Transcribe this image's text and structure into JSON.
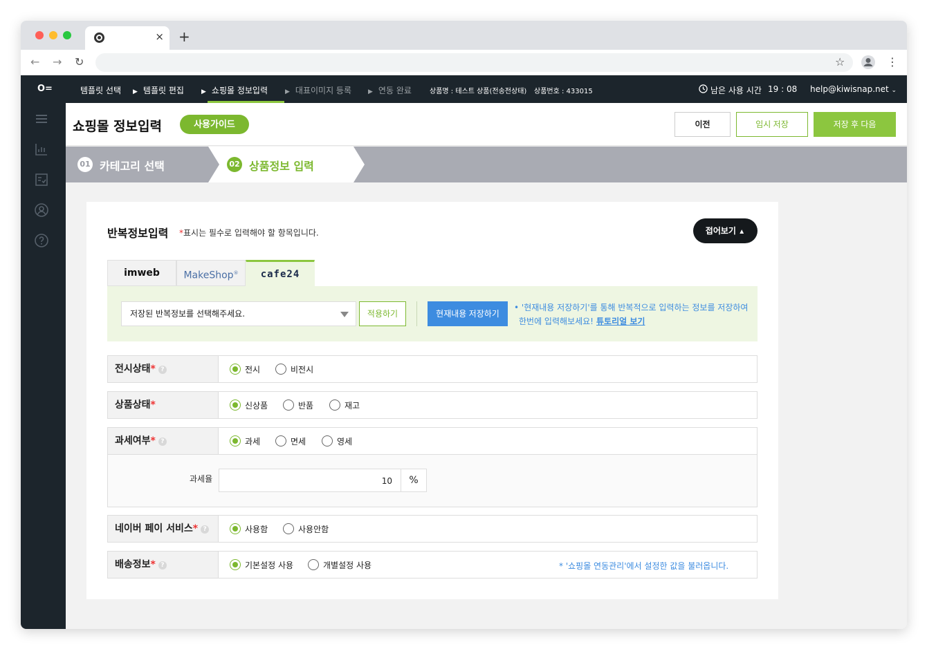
{
  "browser": {
    "tab_close": "×",
    "new_tab": "+",
    "back": "←",
    "forward": "→",
    "reload": "↻",
    "star": "☆",
    "menu": "⋮"
  },
  "topnav": {
    "logo": "O=",
    "steps": [
      {
        "label": "템플릿 선택",
        "active": true
      },
      {
        "label": "템플릿 편집",
        "active": true
      },
      {
        "label": "쇼핑몰 정보입력",
        "active": true
      },
      {
        "label": "대표이미지 등록",
        "active": false
      },
      {
        "label": "연동 완료",
        "active": false
      }
    ],
    "arrow": "▶",
    "product_name": "상품명 : 테스트 상품(전송전상태)",
    "product_no": "상품번호 : 433015",
    "time_label": "남은 사용 시간",
    "time_value": "19 : 08",
    "email": "help@kiwisnap.net"
  },
  "header": {
    "title": "쇼핑몰 정보입력",
    "guide": "사용가이드",
    "prev": "이전",
    "temp_save": "임시 저장",
    "save_next": "저장 후 다음"
  },
  "stepbar": {
    "step1_no": "01",
    "step1": "카테고리 선택",
    "step2_no": "02",
    "step2": "상품정보 입력"
  },
  "section": {
    "title": "반복정보입력",
    "note_star": "*",
    "note": "표시는 필수로 입력해야 할 항목입니다.",
    "fold": "접어보기"
  },
  "platform_tabs": [
    {
      "label": "imweb",
      "active": false
    },
    {
      "label": "MakeShop",
      "sup": "®",
      "active": false
    },
    {
      "label": "cafe24",
      "active": true
    }
  ],
  "repeat": {
    "select_placeholder": "저장된 반복정보를 선택해주세요.",
    "apply": "적용하기",
    "save_current": "현재내용 저장하기",
    "tip1": "• '현재내용 저장하기'를 통해 반복적으로 입력하는 정보를 저장하여",
    "tip2": "한번에 입력해보세요!",
    "tip_link": "튜토리얼 보기"
  },
  "fields": {
    "display": {
      "label": "전시상태",
      "options": [
        "전시",
        "비전시"
      ],
      "selected": 0
    },
    "condition": {
      "label": "상품상태",
      "options": [
        "신상품",
        "반품",
        "재고"
      ],
      "selected": 0
    },
    "tax": {
      "label": "과세여부",
      "options": [
        "과세",
        "면세",
        "영세"
      ],
      "selected": 0
    },
    "tax_rate": {
      "label": "과세율",
      "value": "10",
      "unit": "%"
    },
    "naverpay": {
      "label": "네이버 페이 서비스",
      "options": [
        "사용함",
        "사용안함"
      ],
      "selected": 0
    },
    "delivery": {
      "label": "배송정보",
      "options": [
        "기본설정 사용",
        "개별설정 사용"
      ],
      "selected": 0,
      "note": "* '쇼핑몰 연동관리'에서 설정한 값을 불러옵니다."
    }
  },
  "star": "*",
  "q": "?",
  "colors": {
    "accent": "#7cb82f",
    "dark": "#1c252c",
    "blue": "#3d8ce0",
    "stepbar": "#a9abb3"
  }
}
